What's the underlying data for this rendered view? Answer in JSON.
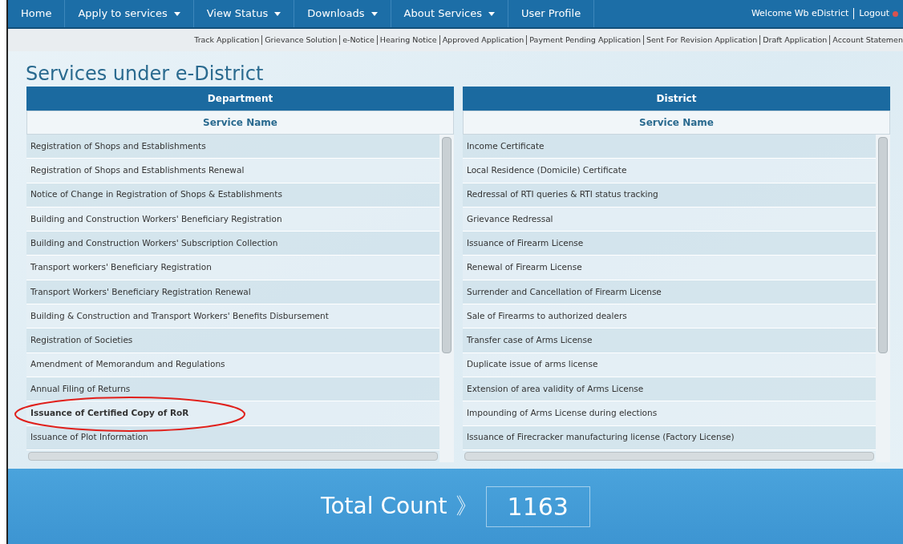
{
  "nav": {
    "items": [
      {
        "label": "Home",
        "dropdown": false
      },
      {
        "label": "Apply to services",
        "dropdown": true
      },
      {
        "label": "View Status",
        "dropdown": true
      },
      {
        "label": "Downloads",
        "dropdown": true
      },
      {
        "label": "About Services",
        "dropdown": true
      },
      {
        "label": "User Profile",
        "dropdown": false
      }
    ],
    "welcome": "Welcome Wb eDistrict",
    "logout": "Logout"
  },
  "quick_links": [
    "Track Application",
    "Grievance Solution",
    "e-Notice",
    "Hearing Notice",
    "Approved Application",
    "Payment Pending Application",
    "Sent For Revision Application",
    "Draft Application",
    "Account Statemen"
  ],
  "title": "Services under e-District",
  "tables": [
    {
      "heading": "Department",
      "column": "Service Name",
      "rows": [
        {
          "name": "Registration of Shops and Establishments",
          "highlighted": false
        },
        {
          "name": "Registration of Shops and Establishments Renewal",
          "highlighted": false
        },
        {
          "name": "Notice of Change in Registration of Shops & Establishments",
          "highlighted": false
        },
        {
          "name": "Building and Construction Workers' Beneficiary Registration",
          "highlighted": false
        },
        {
          "name": "Building and Construction Workers' Subscription Collection",
          "highlighted": false
        },
        {
          "name": "Transport workers' Beneficiary Registration",
          "highlighted": false
        },
        {
          "name": "Transport Workers' Beneficiary Registration Renewal",
          "highlighted": false
        },
        {
          "name": "Building & Construction and Transport Workers' Benefits Disbursement",
          "highlighted": false
        },
        {
          "name": "Registration of Societies",
          "highlighted": false
        },
        {
          "name": "Amendment of Memorandum and Regulations",
          "highlighted": false
        },
        {
          "name": "Annual Filing of Returns",
          "highlighted": false
        },
        {
          "name": "Issuance of Certified Copy of RoR",
          "highlighted": true
        },
        {
          "name": "Issuance of Plot Information",
          "highlighted": false
        }
      ]
    },
    {
      "heading": "District",
      "column": "Service Name",
      "rows": [
        {
          "name": "Income Certificate",
          "highlighted": false
        },
        {
          "name": "Local Residence (Domicile) Certificate",
          "highlighted": false
        },
        {
          "name": "Redressal of RTI queries & RTI status tracking",
          "highlighted": false
        },
        {
          "name": "Grievance Redressal",
          "highlighted": false
        },
        {
          "name": "Issuance of Firearm License",
          "highlighted": false
        },
        {
          "name": "Renewal of Firearm License",
          "highlighted": false
        },
        {
          "name": "Surrender and Cancellation of Firearm License",
          "highlighted": false
        },
        {
          "name": "Sale of Firearms to authorized dealers",
          "highlighted": false
        },
        {
          "name": "Transfer case of Arms License",
          "highlighted": false
        },
        {
          "name": "Duplicate issue of arms license",
          "highlighted": false
        },
        {
          "name": "Extension of area validity of Arms License",
          "highlighted": false
        },
        {
          "name": "Impounding of Arms License during elections",
          "highlighted": false
        },
        {
          "name": "Issuance of Firecracker manufacturing license (Factory License)",
          "highlighted": false
        }
      ]
    }
  ],
  "total": {
    "label": "Total Count",
    "arrow": "》",
    "value": "1163"
  }
}
